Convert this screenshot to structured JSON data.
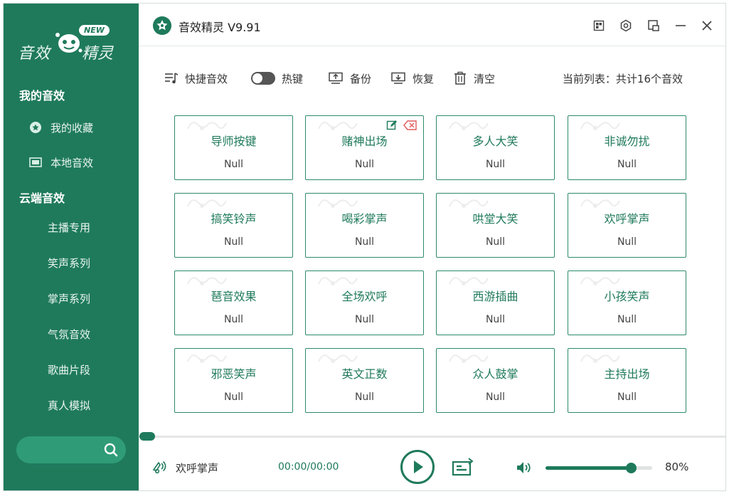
{
  "app": {
    "title": "音效精灵 V9.91",
    "logo_left": "音效",
    "logo_right": "精灵",
    "badge": "NEW"
  },
  "sidebar": {
    "my_section": "我的音效",
    "my_items": [
      {
        "label": "我的收藏",
        "icon": "favorite-icon"
      },
      {
        "label": "本地音效",
        "icon": "local-folder-icon"
      }
    ],
    "cloud_section": "云端音效",
    "cloud_items": [
      "主播专用",
      "笑声系列",
      "掌声系列",
      "气氛音效",
      "歌曲片段",
      "真人模拟"
    ],
    "search": {
      "placeholder": "",
      "value": ""
    }
  },
  "toolbar": {
    "quick": "快捷音效",
    "hotkey": "热键",
    "backup": "备份",
    "restore": "恢复",
    "clear": "清空",
    "list_info": "当前列表：共计16个音效"
  },
  "cards": [
    {
      "name": "导师按键",
      "value": "Null"
    },
    {
      "name": "赌神出场",
      "value": "Null",
      "hover": true
    },
    {
      "name": "多人大笑",
      "value": "Null"
    },
    {
      "name": "非诚勿扰",
      "value": "Null"
    },
    {
      "name": "搞笑铃声",
      "value": "Null"
    },
    {
      "name": "喝彩掌声",
      "value": "Null"
    },
    {
      "name": "哄堂大笑",
      "value": "Null"
    },
    {
      "name": "欢呼掌声",
      "value": "Null"
    },
    {
      "name": "琶音效果",
      "value": "Null"
    },
    {
      "name": "全场欢呼",
      "value": "Null"
    },
    {
      "name": "西游插曲",
      "value": "Null"
    },
    {
      "name": "小孩笑声",
      "value": "Null"
    },
    {
      "name": "邪恶笑声",
      "value": "Null"
    },
    {
      "name": "英文正数",
      "value": "Null"
    },
    {
      "name": "众人鼓掌",
      "value": "Null"
    },
    {
      "name": "主持出场",
      "value": "Null"
    }
  ],
  "player": {
    "now_playing": "欢呼掌声",
    "time": "00:00/00:00",
    "progress": 0,
    "volume": 80,
    "volume_label": "80%"
  },
  "colors": {
    "accent": "#1f7a5c",
    "sidebar_bg": "#1f7a5c",
    "delete": "#e05a5a"
  }
}
